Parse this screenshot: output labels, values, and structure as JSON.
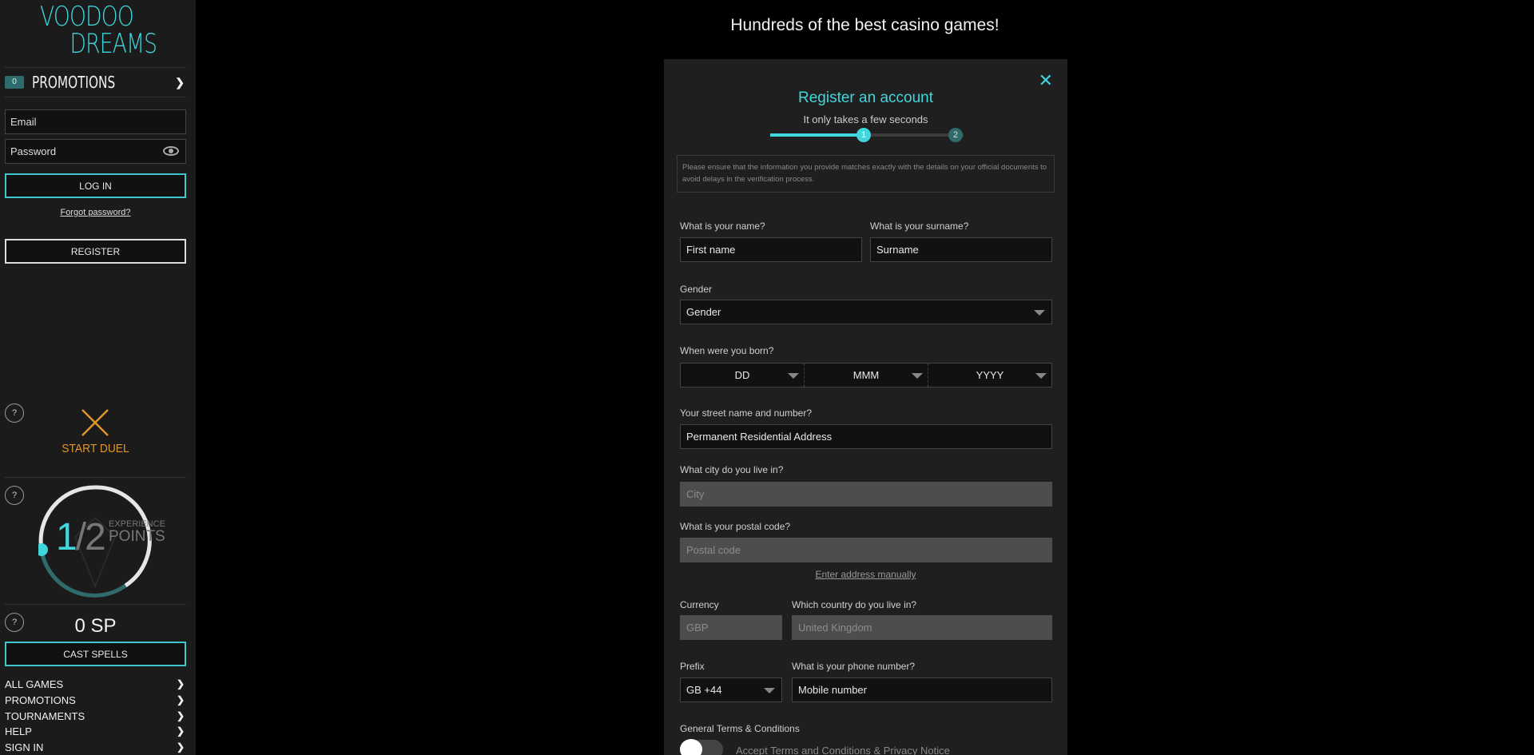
{
  "sidebar": {
    "logo": {
      "line1": "VOODOO",
      "line2": "DREAMS"
    },
    "promotions": {
      "badge": "0",
      "label": "PROMOTIONS"
    },
    "email_placeholder": "Email",
    "password_placeholder": "Password",
    "login_label": "LOG IN",
    "forgot_label": "Forgot password?",
    "register_label": "REGISTER",
    "help_label": "?",
    "duel_label": "START DUEL",
    "xp": {
      "current": "1",
      "slash": "/",
      "total": "2",
      "label_small": "EXPERIENCE",
      "label_big": "POINTS"
    },
    "sp_label": "0 SP",
    "cast_spells_label": "CAST SPELLS",
    "nav": [
      "ALL GAMES",
      "PROMOTIONS",
      "TOURNAMENTS",
      "HELP",
      "SIGN IN"
    ],
    "chevron": "❯"
  },
  "main": {
    "title": "Hundreds of the best casino games!"
  },
  "modal": {
    "close": "✕",
    "title": "Register an account",
    "subtitle": "It only takes a few seconds",
    "progress": 0.5,
    "steps": [
      "1",
      "2"
    ],
    "notice": "Please ensure that the information you provide matches exactly with the details on your official documents to avoid delays in the verification process.",
    "name_label": "What is your name?",
    "name_placeholder": "First name",
    "surname_label": "What is your surname?",
    "surname_placeholder": "Surname",
    "gender_label": "Gender",
    "gender_value": "Gender",
    "dob_label": "When were you born?",
    "dob": {
      "day": "DD",
      "month": "MMM",
      "year": "YYYY"
    },
    "street_label": "Your street name and number?",
    "street_placeholder": "Permanent Residential Address",
    "city_label": "What city do you live in?",
    "city_placeholder": "City",
    "postal_label": "What is your postal code?",
    "postal_placeholder": "Postal code",
    "manual_label": "Enter address manually",
    "currency_label": "Currency",
    "currency_value": "GBP",
    "country_label": "Which country do you live in?",
    "country_value": "United Kingdom",
    "prefix_label": "Prefix",
    "prefix_value": "GB +44",
    "phone_label": "What is your phone number?",
    "phone_placeholder": "Mobile number",
    "terms_label": "General Terms & Conditions",
    "accept_label": "Accept Terms and Conditions & Privacy Notice"
  },
  "colors": {
    "accent": "#3fd6dc",
    "duel": "#e0962c",
    "sidebar_bg": "#1b1b1b",
    "modal_bg": "#1f1f1f"
  }
}
